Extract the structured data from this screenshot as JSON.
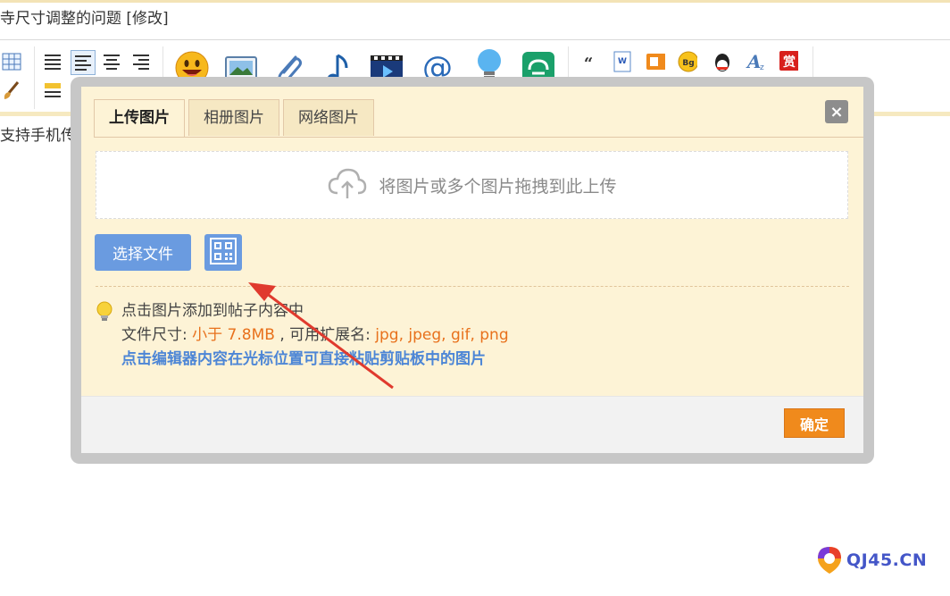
{
  "page": {
    "title": "寺尺寸调整的问题 [修改]",
    "body_text": "支持手机传"
  },
  "toolbar": {
    "icons": [
      "table-icon",
      "align-left-icon",
      "align-justify-icon",
      "align-center-icon",
      "align-right-icon",
      "brush-icon",
      "format-icon",
      "list-icon",
      "indent-icon",
      "outdent-icon",
      "smiley-icon",
      "image-icon",
      "attachment-icon",
      "music-icon",
      "video-icon",
      "at-icon",
      "bulb-icon",
      "link-icon",
      "quote-icon",
      "word-icon",
      "box-icon",
      "bg-icon",
      "qq-icon",
      "font-size-icon",
      "reward-icon"
    ]
  },
  "dialog": {
    "tabs": [
      {
        "label": "上传图片",
        "active": true
      },
      {
        "label": "相册图片",
        "active": false
      },
      {
        "label": "网络图片",
        "active": false
      }
    ],
    "close_label": "×",
    "drop_text": "将图片或多个图片拖拽到此上传",
    "select_file_label": "选择文件",
    "tip_line1": "点击图片添加到帖子内容中",
    "size_prefix": "文件尺寸: ",
    "size_value": "小于 7.8MB",
    "ext_prefix": " , 可用扩展名: ",
    "ext_value": "jpg, jpeg, gif, png",
    "paste_tip": "点击编辑器内容在光标位置可直接粘贴剪贴板中的图片",
    "ok_label": "确定"
  },
  "watermark": {
    "text": "QJ45.CN"
  },
  "colors": {
    "accent_blue": "#6a9be0",
    "accent_orange": "#f08a1c",
    "dialog_bg": "#fdf3d6",
    "arrow": "#e03a2e"
  }
}
